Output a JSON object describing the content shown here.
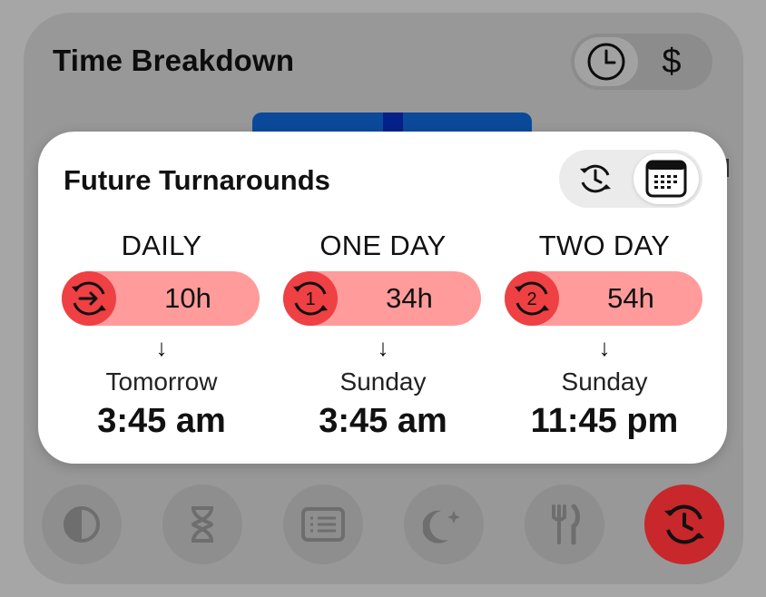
{
  "background": {
    "title": "Time Breakdown",
    "toggle": {
      "options": [
        {
          "icon": "clock-icon",
          "selected": true
        },
        {
          "icon": "dollar-icon",
          "label": "$",
          "selected": false
        }
      ]
    },
    "nav_icons": [
      {
        "icon": "contrast-icon",
        "active": false
      },
      {
        "icon": "hourglass-icon",
        "active": false
      },
      {
        "icon": "list-icon",
        "active": false
      },
      {
        "icon": "moon-stars-icon",
        "active": false
      },
      {
        "icon": "fork-knife-icon",
        "active": false
      },
      {
        "icon": "turnaround-clock-icon",
        "active": true
      }
    ]
  },
  "card": {
    "title": "Future Turnarounds",
    "view_toggle": {
      "options": [
        {
          "icon": "history-clock-icon",
          "selected": false
        },
        {
          "icon": "calendar-icon",
          "selected": true
        }
      ]
    },
    "columns": [
      {
        "label": "DAILY",
        "badge_icon": "turnaround-arrow-icon",
        "value": "10h",
        "arrow": "↓",
        "day": "Tomorrow",
        "time": "3:45 am"
      },
      {
        "label": "ONE DAY",
        "badge_icon": "turnaround-1-icon",
        "badge_text": "1",
        "value": "34h",
        "arrow": "↓",
        "day": "Sunday",
        "time": "3:45 am"
      },
      {
        "label": "TWO DAY",
        "badge_icon": "turnaround-2-icon",
        "badge_text": "2",
        "value": "54h",
        "arrow": "↓",
        "day": "Sunday",
        "time": "11:45 pm"
      }
    ]
  },
  "colors": {
    "pill": "#ff9b9b",
    "badge": "#ef4044",
    "active_nav": "#c8272b",
    "bar": "#0b4a9b"
  }
}
